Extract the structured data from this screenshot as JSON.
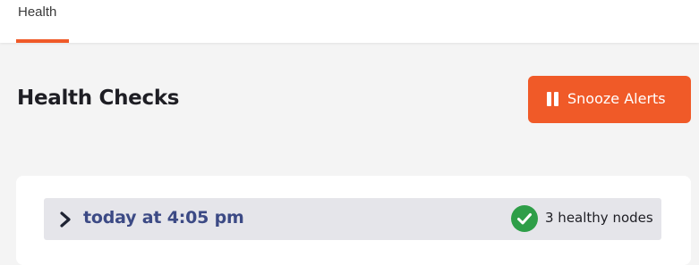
{
  "nav": {
    "tabs": [
      {
        "label": "Health",
        "active": true
      }
    ]
  },
  "header": {
    "title": "Health Checks",
    "snooze_label": "Snooze Alerts"
  },
  "checks": [
    {
      "time": "today at 4:05 pm",
      "status": "3 healthy nodes",
      "status_icon": "check-circle-icon",
      "expanded": false
    }
  ],
  "colors": {
    "accent": "#f05a28",
    "status_ok": "#2e9e48",
    "time_text": "#3c4a85",
    "row_bg": "#e5e5ea",
    "page_bg": "#f4f4f4"
  }
}
